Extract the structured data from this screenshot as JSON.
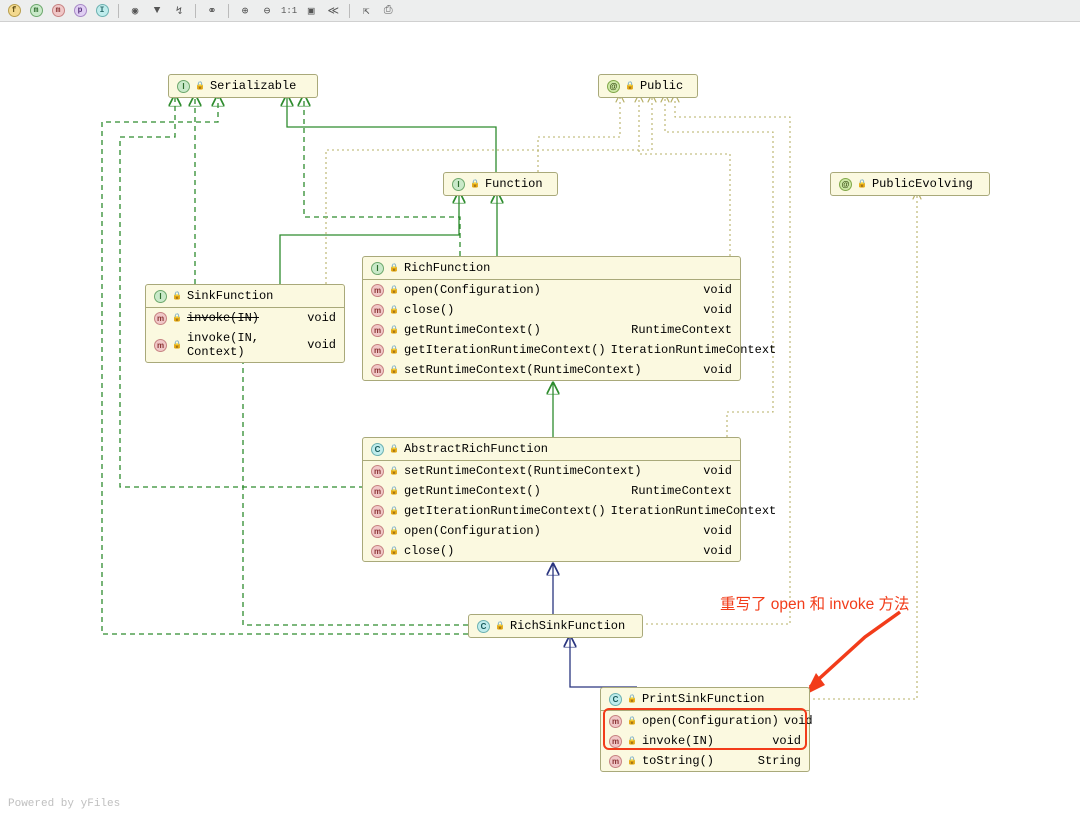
{
  "toolbar": {
    "badges": [
      "f",
      "m",
      "m",
      "p",
      "I"
    ],
    "one_to_one": "1:1"
  },
  "nodes": {
    "serializable": {
      "title": "Serializable"
    },
    "public": {
      "title": "Public"
    },
    "function": {
      "title": "Function"
    },
    "publicEvolving": {
      "title": "PublicEvolving"
    },
    "sinkFunction": {
      "title": "SinkFunction",
      "rows": [
        {
          "sig": "invoke(IN)",
          "ret": "void",
          "striked": true
        },
        {
          "sig": "invoke(IN, Context)",
          "ret": "void"
        }
      ]
    },
    "richFunction": {
      "title": "RichFunction",
      "rows": [
        {
          "sig": "open(Configuration)",
          "ret": "void"
        },
        {
          "sig": "close()",
          "ret": "void"
        },
        {
          "sig": "getRuntimeContext()",
          "ret": "RuntimeContext"
        },
        {
          "sig": "getIterationRuntimeContext()",
          "ret": "IterationRuntimeContext"
        },
        {
          "sig": "setRuntimeContext(RuntimeContext)",
          "ret": "void"
        }
      ]
    },
    "abstractRichFunction": {
      "title": "AbstractRichFunction",
      "rows": [
        {
          "sig": "setRuntimeContext(RuntimeContext)",
          "ret": "void"
        },
        {
          "sig": "getRuntimeContext()",
          "ret": "RuntimeContext"
        },
        {
          "sig": "getIterationRuntimeContext()",
          "ret": "IterationRuntimeContext"
        },
        {
          "sig": "open(Configuration)",
          "ret": "void"
        },
        {
          "sig": "close()",
          "ret": "void"
        }
      ]
    },
    "richSinkFunction": {
      "title": "RichSinkFunction"
    },
    "printSinkFunction": {
      "title": "PrintSinkFunction",
      "rows": [
        {
          "sig": "open(Configuration)",
          "ret": "void"
        },
        {
          "sig": "invoke(IN)",
          "ret": "void"
        },
        {
          "sig": "toString()",
          "ret": "String"
        }
      ]
    }
  },
  "annotation": "重写了 open 和 invoke 方法",
  "footer": "Powered by yFiles"
}
